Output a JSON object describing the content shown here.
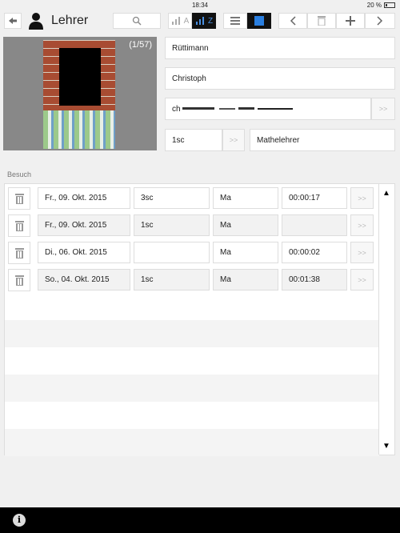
{
  "status": {
    "time": "18:34",
    "battery": "20 %"
  },
  "toolbar": {
    "title": "Lehrer",
    "back_icon": "back-arrow-icon",
    "user_icon": "person-icon",
    "search_icon": "search-icon",
    "sort_labels": {
      "sort_a": "A",
      "sort_z": "Z"
    }
  },
  "photo": {
    "counter": "(1/57)"
  },
  "fields": {
    "last_name": "Rüttimann",
    "first_name": "Christoph",
    "email_prefix": "ch",
    "class_code": "1sc",
    "role": "Mathelehrer",
    "more": ">>"
  },
  "section": {
    "label": "Besuch"
  },
  "visits": [
    {
      "date": "Fr., 09. Okt. 2015",
      "class": "3sc",
      "subject": "Ma",
      "duration": "00:00:17",
      "more": ">>"
    },
    {
      "date": "Fr., 09. Okt. 2015",
      "class": "1sc",
      "subject": "Ma",
      "duration": "",
      "more": ">>"
    },
    {
      "date": "Di., 06. Okt. 2015",
      "class": "",
      "subject": "Ma",
      "duration": "00:00:02",
      "more": ">>"
    },
    {
      "date": "So., 04. Okt. 2015",
      "class": "1sc",
      "subject": "Ma",
      "duration": "00:01:38",
      "more": ">>"
    }
  ],
  "scroll": {
    "up": "▲",
    "down": "▼"
  },
  "footer": {
    "info": "i"
  }
}
